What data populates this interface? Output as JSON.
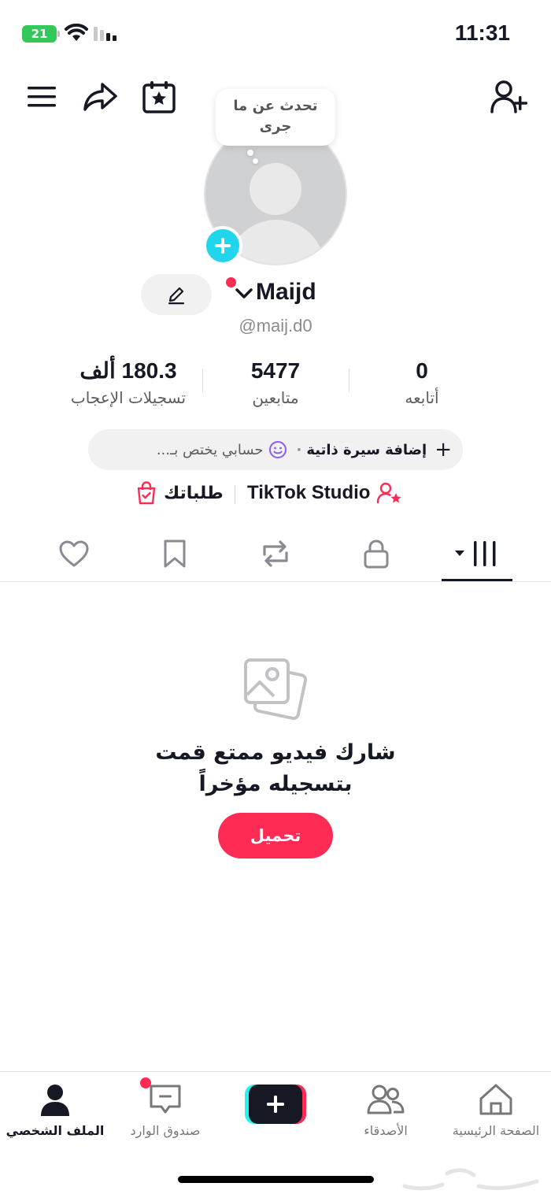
{
  "status_bar": {
    "battery": "21",
    "time": "11:31"
  },
  "profile": {
    "bubble_text_line1": "تحدث عن ما",
    "bubble_text_line2": "جرى",
    "display_name": "Maijd",
    "username": "@maij.d0"
  },
  "stats": {
    "following_value": "0",
    "following_label": "أتابعه",
    "followers_value": "5477",
    "followers_label": "متابعين",
    "likes_value": "180.3 ألف",
    "likes_label": "تسجيلات الإعجاب"
  },
  "bio": {
    "add_bio": "إضافة سيرة ذاتية",
    "separator": "·",
    "account_text": "حسابي يختص بـ..."
  },
  "links": {
    "studio": "TikTok Studio",
    "orders": "طلباتك"
  },
  "tabs": [
    {
      "name": "videos",
      "icon": "grid-icon",
      "active": true
    },
    {
      "name": "private",
      "icon": "lock-icon",
      "active": false
    },
    {
      "name": "reposts",
      "icon": "repost-icon",
      "active": false
    },
    {
      "name": "favorites",
      "icon": "bookmark-icon",
      "active": false
    },
    {
      "name": "liked",
      "icon": "heart-icon",
      "active": false
    }
  ],
  "empty_state": {
    "title_line1": "شارك فيديو ممتع قمت",
    "title_line2": "بتسجيله مؤخراً",
    "upload_button": "تحميل"
  },
  "bottom_nav": {
    "home": "الصفحة الرئيسية",
    "friends": "الأصدقاء",
    "inbox": "صندوق الوارد",
    "profile": "الملف الشخصي"
  },
  "colors": {
    "accent": "#fe2c55",
    "cyan": "#20d5ec",
    "text": "#161823",
    "battery": "#34c759"
  }
}
